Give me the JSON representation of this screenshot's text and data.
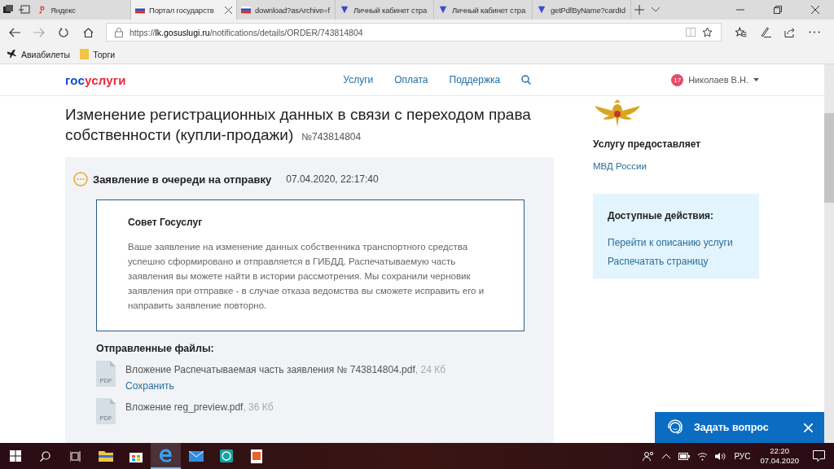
{
  "browser": {
    "tabs": [
      {
        "kind": "yandex",
        "title": "Яндекс",
        "selected": false
      },
      {
        "kind": "flag",
        "title": "Портал государств",
        "selected": true
      },
      {
        "kind": "flag",
        "title": "download?asArchive=f",
        "selected": false
      },
      {
        "kind": "shield",
        "title": "Личный кабинет стра",
        "selected": false
      },
      {
        "kind": "shield",
        "title": "Личный кабинет стра",
        "selected": false
      },
      {
        "kind": "shield",
        "title": "getPdfByName?cardId",
        "selected": false
      }
    ],
    "url_prefix": "https://",
    "url_host": "lk.gosuslugi.ru",
    "url_path": "/notifications/details/ORDER/743814804",
    "bookmarks": [
      {
        "kind": "plane",
        "label": "Авиабилеты"
      },
      {
        "kind": "folder",
        "label": "Торги"
      }
    ]
  },
  "header": {
    "logo_a": "гос",
    "logo_b": "услуги",
    "nav": [
      "Услуги",
      "Оплата",
      "Поддержка"
    ],
    "badge": "17",
    "user": "Николаев В.Н."
  },
  "title_lines": [
    "Изменение регистрационных данных в связи с переходом права",
    "собственности (купли-продажи)"
  ],
  "order_number": "№743814804",
  "status": {
    "label": "Заявление в очереди на отправку",
    "time": "07.04.2020, 22:17:40"
  },
  "advice": {
    "title": "Совет Госуслуг",
    "text": "Ваше заявление на изменение данных собственника транспортного средства успешно сформировано и отправляется в ГИБДД. Распечатываемую часть заявления вы можете найти в истории рассмотрения. Мы сохранили черновик заявления при отправке - в случае отказа ведомства вы сможете исправить его и направить заявление повторно."
  },
  "files": {
    "heading": "Отправленные файлы:",
    "items": [
      {
        "icon_label": "PDF",
        "name": "Вложение Распечатываемая часть заявления № 743814804.pdf",
        "size": ", 24 Кб",
        "action": "Сохранить"
      },
      {
        "icon_label": "PDF",
        "name": "Вложение reg_preview.pdf",
        "size": ", 36 Кб"
      }
    ]
  },
  "provider": {
    "heading": "Услугу предоставляет",
    "name": "МВД России"
  },
  "actions": {
    "heading": "Доступные действия:",
    "links": [
      "Перейти к описанию услуги",
      "Распечатать страницу"
    ]
  },
  "chat": {
    "label": "Задать вопрос"
  },
  "taskbar": {
    "lang": "РУС",
    "time": "22:20",
    "date": "07.04.2020"
  }
}
